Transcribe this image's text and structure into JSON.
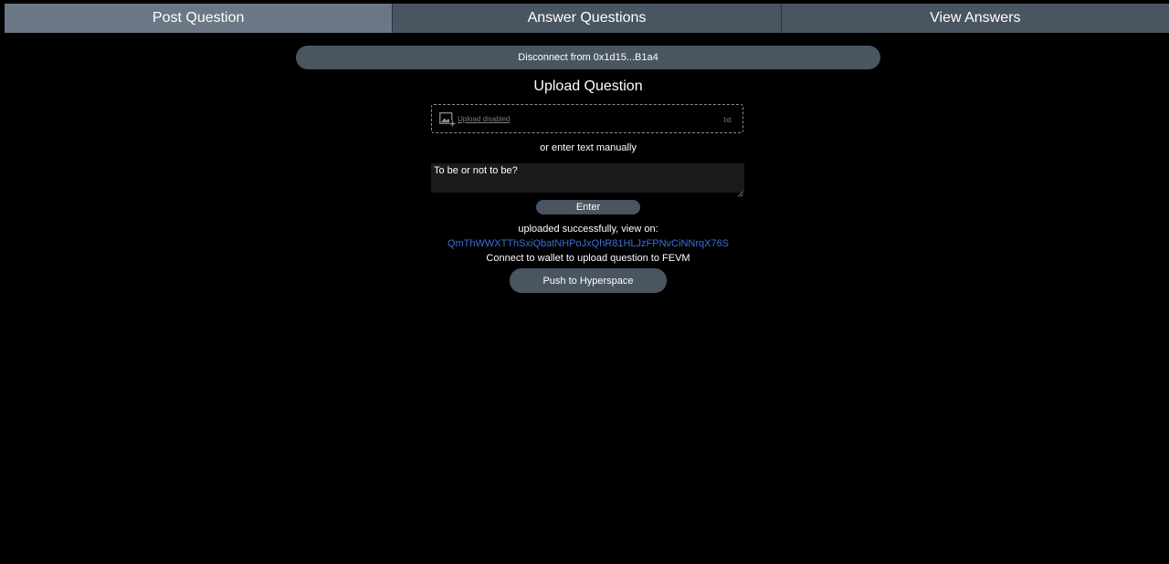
{
  "tabs": [
    {
      "label": "Post Question",
      "active": true
    },
    {
      "label": "Answer Questions",
      "active": false
    },
    {
      "label": "View Answers",
      "active": false
    }
  ],
  "wallet": {
    "disconnect_label": "Disconnect from 0x1d15...B1a4"
  },
  "upload": {
    "title": "Upload Question",
    "dropzone_text": "Upload disabled",
    "dropzone_filetype": "txt",
    "manual_label": "or enter text manually",
    "textarea_value": "To be or not to be?",
    "enter_label": "Enter"
  },
  "result": {
    "status_text": "uploaded successfully, view on:",
    "cid": "QmThWWXTThSxiQbatNHPoJxQhR81HLJzFPNvCiNNrqX76S",
    "connect_message": "Connect to wallet to upload question to FEVM",
    "push_label": "Push to Hyperspace"
  },
  "colors": {
    "background": "#000000",
    "button": "#4a5562",
    "active_tab": "#6b7785",
    "link": "#3b6fd8"
  }
}
